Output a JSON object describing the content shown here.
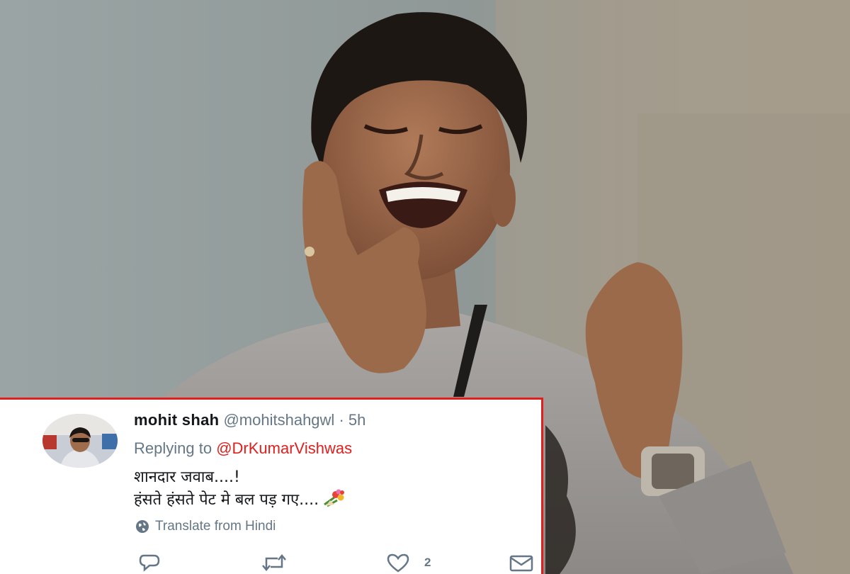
{
  "tweet": {
    "display_name": "mohit shah",
    "handle": "@mohitshahgwl",
    "separator": "·",
    "time": "5h",
    "replying_to_label": "Replying to",
    "replying_to_handle": "@DrKumarVishwas",
    "text_line_1": "शानदार जवाब....!",
    "text_line_2": "हंसते हंसते पेट मे बल पड़ गए....",
    "translate_label": "Translate from Hindi",
    "like_count": "2"
  },
  "icons": {
    "reply": "reply-icon",
    "retweet": "retweet-icon",
    "like": "heart-icon",
    "message": "envelope-icon",
    "translate": "globe-icon",
    "emoji": "bouquet-icon"
  },
  "colors": {
    "highlight_border": "#e0201e",
    "mention": "#e0201e",
    "secondary_text": "#657786",
    "primary_text": "#14171a"
  }
}
